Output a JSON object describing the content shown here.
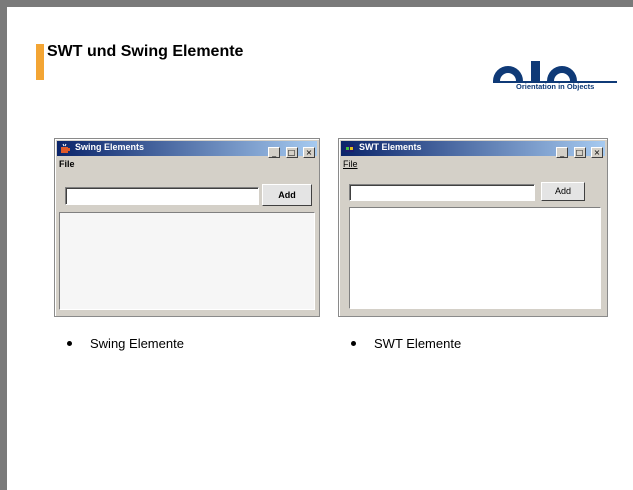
{
  "slide": {
    "title": "SWT und Swing Elemente",
    "logo_text": "Orientation in Objects",
    "accent_color": "#f3a534",
    "logo_color": "#0f3a77"
  },
  "swing_window": {
    "title": "Swing Elements",
    "menu_file": "File",
    "add_label": "Add",
    "minimize_glyph": "_",
    "maximize_glyph": "□",
    "close_glyph": "×",
    "text_value": ""
  },
  "swt_window": {
    "title": "SWT Elements",
    "menu_file": "File",
    "add_label": "Add",
    "minimize_glyph": "_",
    "maximize_glyph": "□",
    "close_glyph": "×",
    "text_value": ""
  },
  "bullets": {
    "swing": "Swing Elemente",
    "swt": "SWT Elemente"
  }
}
